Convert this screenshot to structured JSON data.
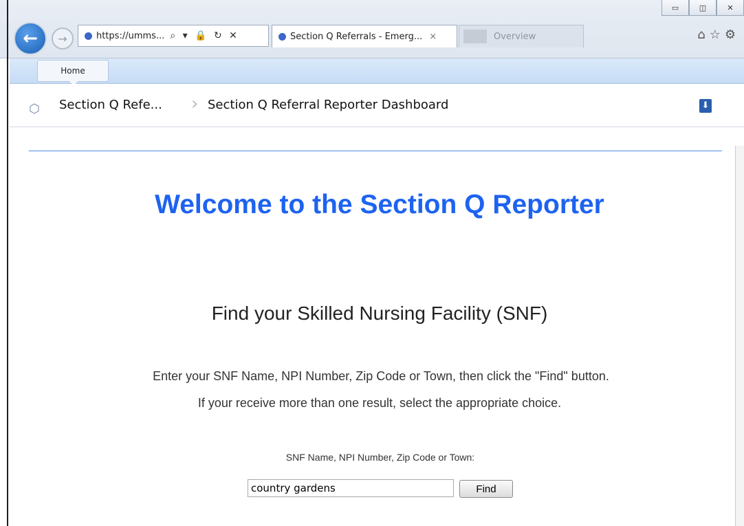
{
  "browser": {
    "address": "https://umms...",
    "address_tools": "⌕ ▾ 🔒 ↻ ✕",
    "active_tab": "Section Q Referrals - Emerg...",
    "inactive_tab": "Overview",
    "tab_close": "×",
    "window_controls": [
      "▭",
      "◫",
      "✕"
    ]
  },
  "menu": {
    "home_label": "Home"
  },
  "breadcrumb": {
    "first": "Section Q Refe...",
    "separator": "›",
    "second": "Section Q Referral Reporter Dashboard",
    "icon": "cube-icon",
    "download_icon": "download-icon"
  },
  "main": {
    "welcome": "Welcome to the Section Q Reporter",
    "find_title": "Find your Skilled Nursing Facility (SNF)",
    "instruction_1": "Enter your SNF Name, NPI Number, Zip Code or Town, then click the \"Find\" button.",
    "instruction_2": "If your receive more than one result, select the appropriate choice.",
    "field_label": "SNF Name, NPI Number, Zip Code or Town:",
    "search_value": "country gardens",
    "find_button": "Find"
  },
  "colors": {
    "welcome": "#1e63f0",
    "rule": "#4f8be0"
  }
}
